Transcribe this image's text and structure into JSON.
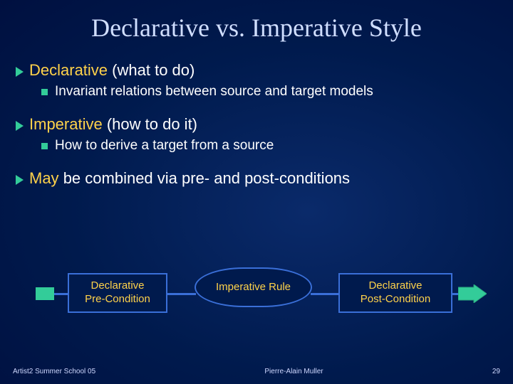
{
  "title": "Declarative vs. Imperative Style",
  "bullets": {
    "declarative": {
      "label": "Declarative",
      "paren": "(what to do)"
    },
    "declarative_sub": "Invariant relations between source and target models",
    "imperative": {
      "label": "Imperative",
      "paren": "(how to do it)"
    },
    "imperative_sub": "How to derive a target from a source",
    "may": {
      "label": "May",
      "rest": "be combined via pre- and post-conditions"
    }
  },
  "diagram": {
    "box1": "Declarative\nPre-Condition",
    "box2": "Imperative Rule",
    "box3": "Declarative\nPost-Condition"
  },
  "footer": {
    "left": "Artist2 Summer School 05",
    "center": "Pierre-Alain Muller",
    "right": "29"
  }
}
